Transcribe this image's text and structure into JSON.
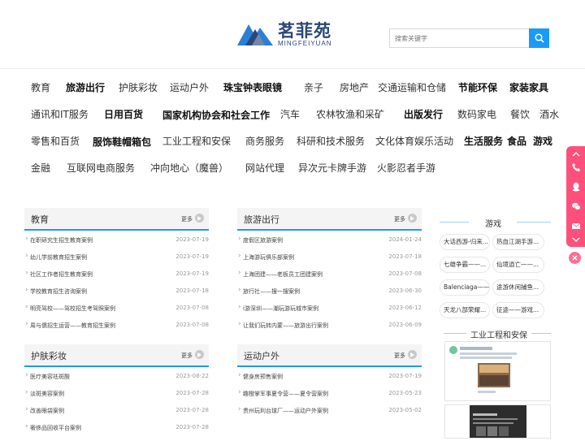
{
  "brand": {
    "name_cn": "茗菲苑",
    "name_en": "MINGFEIYUAN",
    "accent": "#1a9bf5",
    "logo_color": "#2b4778"
  },
  "search": {
    "placeholder": "搜索关键字"
  },
  "categories": [
    {
      "label": "教育",
      "bold": false
    },
    {
      "label": "旅游出行",
      "bold": true
    },
    {
      "label": "护肤彩妆",
      "bold": false
    },
    {
      "label": "运动户外",
      "bold": false
    },
    {
      "label": "珠宝钟表眼镜",
      "bold": true
    },
    {
      "label": "亲子",
      "bold": false
    },
    {
      "label": "房地产",
      "bold": false
    },
    {
      "label": "交通运输和仓储",
      "bold": false
    },
    {
      "label": "节能环保",
      "bold": true
    },
    {
      "label": "家装家具",
      "bold": true
    },
    {
      "label": "通讯和IT服务",
      "bold": false
    },
    {
      "label": "日用百货",
      "bold": true
    },
    {
      "label": "国家机构协会和社会工作",
      "bold": true
    },
    {
      "label": "汽车",
      "bold": false
    },
    {
      "label": "农林牧渔和采矿",
      "bold": false
    },
    {
      "label": "出版发行",
      "bold": true
    },
    {
      "label": "数码家电",
      "bold": false
    },
    {
      "label": "餐饮",
      "bold": false
    },
    {
      "label": "酒水",
      "bold": false
    },
    {
      "label": "零售和百货",
      "bold": false
    },
    {
      "label": "服饰鞋帽箱包",
      "bold": true
    },
    {
      "label": "工业工程和安保",
      "bold": false
    },
    {
      "label": "商务服务",
      "bold": false
    },
    {
      "label": "科研和技术服务",
      "bold": false
    },
    {
      "label": "文化体育娱乐活动",
      "bold": false
    },
    {
      "label": "生活服务",
      "bold": true
    },
    {
      "label": "食品",
      "bold": true
    },
    {
      "label": "游戏",
      "bold": true
    },
    {
      "label": "金融",
      "bold": false
    },
    {
      "label": "互联网电商服务",
      "bold": false
    },
    {
      "label": "冲向地心（魔兽）",
      "bold": false
    },
    {
      "label": "网站代理",
      "bold": false
    },
    {
      "label": "异次元卡牌手游",
      "bold": false
    },
    {
      "label": "火影忍者手游",
      "bold": false
    }
  ],
  "panels": [
    {
      "title": "教育",
      "more": "更多",
      "rows": [
        {
          "title": "在职研究生招生教育案例",
          "date": "2023-07-19"
        },
        {
          "title": "幼儿学前教育招生案例",
          "date": "2023-07-19"
        },
        {
          "title": "社区工作者招生教育案例",
          "date": "2023-07-19"
        },
        {
          "title": "学校教育招生咨询案例",
          "date": "2023-07-18"
        },
        {
          "title": "明亮驾校——驾校招生考驾照案例",
          "date": "2023-07-08"
        },
        {
          "title": "周与儒招生运营——教育招生案例",
          "date": "2023-07-08"
        }
      ]
    },
    {
      "title": "旅游出行",
      "more": "更多",
      "rows": [
        {
          "title": "度假区旅游案例",
          "date": "2024-01-24"
        },
        {
          "title": "上海游玩俱乐部案例",
          "date": "2023-07-18"
        },
        {
          "title": "上海团建——老板员工团建案例",
          "date": "2023-07-08"
        },
        {
          "title": "旅行社——搜一搜案例",
          "date": "2023-06-30"
        },
        {
          "title": "i游深圳——潮玩游玩城市案例",
          "date": "2023-06-12"
        },
        {
          "title": "让我们玩转内蒙——旅游出行案例",
          "date": "2023-06-09"
        }
      ]
    },
    {
      "title": "护肤彩妆",
      "more": "更多",
      "rows": [
        {
          "title": "医疗美容祛斑酸",
          "date": "2023-08-22"
        },
        {
          "title": "淡斑美容案例",
          "date": "2023-07-28"
        },
        {
          "title": "改善眼袋案例",
          "date": "2023-07-28"
        },
        {
          "title": "奢侈品回收平台案例",
          "date": "2023-07-28"
        }
      ]
    },
    {
      "title": "运动户外",
      "more": "更多",
      "rows": [
        {
          "title": "健身房预售案例",
          "date": "2023-07-19"
        },
        {
          "title": "趣橙掌军事夏令营——夏令营案例",
          "date": "2023-05-23"
        },
        {
          "title": "贵州玩利台球厂——运动户外案例",
          "date": "2023-05-02"
        }
      ]
    }
  ],
  "sidebar": {
    "games_title": "游戏",
    "games_tags": [
      "大话西游-归来...",
      "热血江湖手游...",
      "七雄争霸——...",
      "仙境逍亡——...",
      "Balenciaga——...",
      "途游休闲捕鱼...",
      "天龙八部荣耀...",
      "征途——游戏..."
    ],
    "industry_title": "工业工程和安保"
  }
}
